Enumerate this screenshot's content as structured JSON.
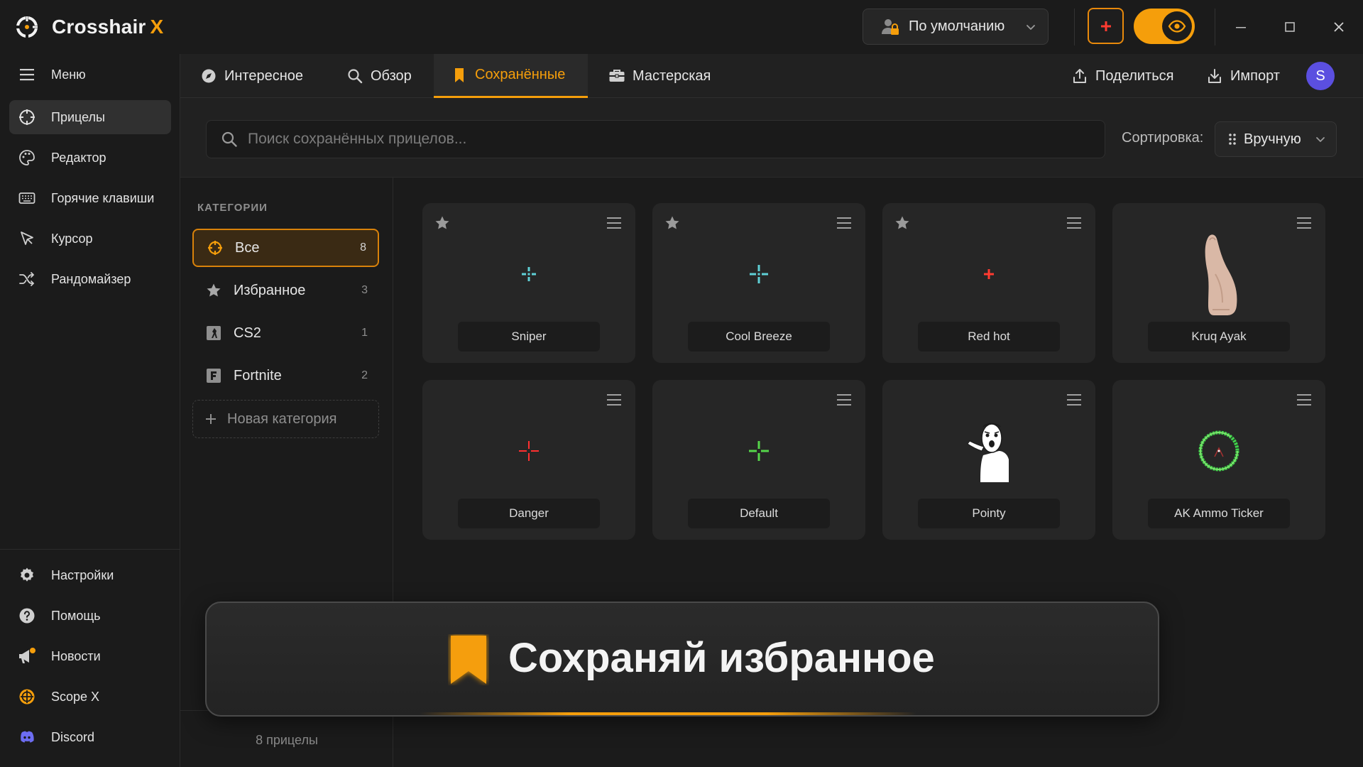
{
  "app": {
    "brand_name": "Crosshair",
    "brand_suffix": "X",
    "accent_color": "#f59e0b"
  },
  "titlebar": {
    "profile_label": "По умолчанию",
    "profile_icon": "user-lock-icon",
    "add_icon": "plus-icon",
    "toggle_icon": "eye-icon",
    "toggle_on": true
  },
  "sidebar": {
    "top_items": [
      {
        "label": "Меню",
        "icon": "hamburger-icon"
      },
      {
        "label": "Прицелы",
        "icon": "crosshair-icon",
        "active": true
      },
      {
        "label": "Редактор",
        "icon": "palette-icon"
      },
      {
        "label": "Горячие клавиши",
        "icon": "keyboard-icon"
      },
      {
        "label": "Курсор",
        "icon": "cursor-icon"
      },
      {
        "label": "Рандомайзер",
        "icon": "shuffle-icon"
      }
    ],
    "bottom_items": [
      {
        "label": "Настройки",
        "icon": "gear-icon"
      },
      {
        "label": "Помощь",
        "icon": "help-icon"
      },
      {
        "label": "Новости",
        "icon": "megaphone-icon"
      },
      {
        "label": "Scope X",
        "icon": "scope-icon"
      },
      {
        "label": "Discord",
        "icon": "discord-icon"
      }
    ]
  },
  "tabs": [
    {
      "label": "Интересное",
      "icon": "compass-icon"
    },
    {
      "label": "Обзор",
      "icon": "search-icon"
    },
    {
      "label": "Сохранённые",
      "icon": "bookmark-icon",
      "active": true
    },
    {
      "label": "Мастерская",
      "icon": "toolbox-icon"
    }
  ],
  "actions": {
    "share_label": "Поделиться",
    "import_label": "Импорт",
    "avatar_letter": "S",
    "avatar_color": "#5b4fe0"
  },
  "search": {
    "placeholder": "Поиск сохранённых прицелов...",
    "value": "",
    "sort_label": "Сортировка:",
    "sort_value": "Вручную"
  },
  "categories": {
    "heading": "КАТЕГОРИИ",
    "items": [
      {
        "label": "Все",
        "count": "8",
        "icon": "crosshair-icon",
        "active": true
      },
      {
        "label": "Избранное",
        "count": "3",
        "icon": "star-icon"
      },
      {
        "label": "CS2",
        "count": "1",
        "icon": "cs2-icon"
      },
      {
        "label": "Fortnite",
        "count": "2",
        "icon": "fortnite-icon"
      }
    ],
    "new_label": "Новая категория",
    "footer": "8 прицелы"
  },
  "crosshairs": [
    {
      "name": "Sniper",
      "starred": true,
      "preview": "dot-cross",
      "color": "#5fd0d6"
    },
    {
      "name": "Cool Breeze",
      "starred": true,
      "preview": "dot-cross",
      "color": "#5fd0d6"
    },
    {
      "name": "Red hot",
      "starred": true,
      "preview": "plus",
      "color": "#ff3b30"
    },
    {
      "name": "Kruq Ayak",
      "starred": false,
      "preview": "foot-image",
      "color": "#d9b8a6"
    },
    {
      "name": "Danger",
      "starred": false,
      "preview": "thin-cross",
      "color": "#ff3030"
    },
    {
      "name": "Default",
      "starred": false,
      "preview": "thin-cross",
      "color": "#55d64a"
    },
    {
      "name": "Pointy",
      "starred": false,
      "preview": "meme-image",
      "color": "#ffffff"
    },
    {
      "name": "AK Ammo Ticker",
      "starred": false,
      "preview": "ring",
      "color": "#3fd14a"
    }
  ],
  "banner": {
    "text": "Сохраняй избранное",
    "icon": "bookmark-icon"
  }
}
